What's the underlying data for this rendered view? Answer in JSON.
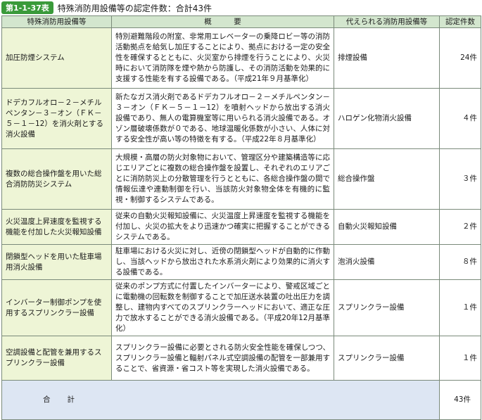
{
  "caption": {
    "badge": "第1-1-37表",
    "title": "特殊消防用設備等の認定件数：合計43件"
  },
  "table": {
    "headers": [
      "特殊消防用設備等",
      "概　　　要",
      "代えられる消防用設備等",
      "認定件数"
    ],
    "rows": [
      {
        "name": "加圧防煙システム",
        "desc": "特別避難階段の附室、非常用エレベーターの乗降ロビー等の消防活動拠点を給気し加圧することにより、拠点における一定の安全性を確保するとともに、火災室から排煙を行うことにより、火災時において消防隊を煙や熱から防護し、その消防活動を効果的に支援する性能を有する設備である。（平成21年９月基準化）",
        "alt": "排煙設備",
        "count": "24件"
      },
      {
        "name": "ドデカフルオロ－２－メチルペンタン－３－オン（ＦＫ－５－１－12）を消火剤とする消火設備",
        "desc": "新たなガス消火剤であるドデカフルオロ－２－メチルペンタン－３－オン（ＦＫ－５－１－12）を噴射ヘッドから放出する消火設備であり、無人の電算機室等に用いられる消火設備である。オゾン層破壊係数が０である、地球温暖化係数が小さい、人体に対する安全性が高い等の特徴を有する。（平成22年８月基準化）",
        "alt": "ハロゲン化物消火設備",
        "count": "４件"
      },
      {
        "name": "複数の総合操作盤を用いた総合消防防災システム",
        "desc": "大規模・高層の防火対象物において、管理区分や建築構造等に応じエリアごとに複数の総合操作盤を設置し、それぞれのエリアごとに消防防災上の分散管理を行うとともに、各総合操作盤の間で情報伝達や連動制御を行い、当該防火対象物全体を有機的に監視・制御するシステムである。",
        "alt": "総合操作盤",
        "count": "３件"
      },
      {
        "name": "火災温度上昇速度を監視する機能を付加した火災報知設備",
        "desc": "従来の自動火災報知設備に、火災温度上昇速度を監視する機能を付加し、火災の拡大をより迅速かつ確実に把握することができるシステムである。",
        "alt": "自動火災報知設備",
        "count": "２件"
      },
      {
        "name": "閉鎖型ヘッドを用いた駐車場用消火設備",
        "desc": "駐車場における火災に対し、近傍の閉鎖型ヘッドが自動的に作動し、当該ヘッドから放出された水系消火剤により効果的に消火する設備である。",
        "alt": "泡消火設備",
        "count": "８件"
      },
      {
        "name": "インバーター制御ポンプを使用するスプリンクラー設備",
        "desc": "従来のポンプ方式に付置したインバーターにより、警戒区域ごとに電動機の回転数を制御することで加圧送水装置の吐出圧力を調整し、建物内すべてのスプリンクラーヘッドにおいて、適正な圧力で放水することができる消火設備である。（平成20年12月基準化）",
        "alt": "スプリンクラー設備",
        "count": "１件"
      },
      {
        "name": "空調設備と配管を兼用するスプリンクラー設備",
        "desc": "スプリンクラー設備に必要とされる防火安全性能を確保しつつ、スプリンクラー設備と輻射パネル式空調設備の配管を一部兼用することで、省資源・省コスト等を実現した消火設備である。",
        "alt": "スプリンクラー設備",
        "count": "１件"
      }
    ],
    "total_label": "合計",
    "total_count": "43件"
  }
}
